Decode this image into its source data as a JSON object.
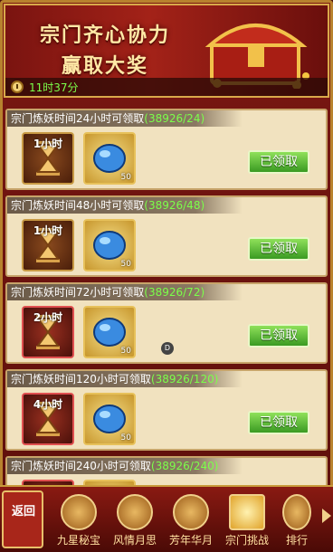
{
  "banner": {
    "title_line1": "宗门齐心协力",
    "title_line2": "赢取大奖",
    "time_left": "11时37分"
  },
  "rewards": [
    {
      "label": "宗门炼妖时间24小时可领取",
      "progress": "(38926/24)",
      "hourglass_text": "1小时",
      "gem_count": "50",
      "button": "已领取",
      "highlight": false
    },
    {
      "label": "宗门炼妖时间48小时可领取",
      "progress": "(38926/48)",
      "hourglass_text": "1小时",
      "gem_count": "50",
      "button": "已领取",
      "highlight": false
    },
    {
      "label": "宗门炼妖时间72小时可领取",
      "progress": "(38926/72)",
      "hourglass_text": "2小时",
      "gem_count": "50",
      "button": "已领取",
      "highlight": true
    },
    {
      "label": "宗门炼妖时间120小时可领取",
      "progress": "(38926/120)",
      "hourglass_text": "4小时",
      "gem_count": "50",
      "button": "已领取",
      "highlight": true
    },
    {
      "label": "宗门炼妖时间240小时可领取",
      "progress": "(38926/240)",
      "hourglass_text": "",
      "gem_count": "",
      "button": "",
      "highlight": true
    }
  ],
  "debug_badge": "D",
  "nav": {
    "back_label": "返回",
    "tabs": [
      {
        "label": "九星秘宝",
        "icon": "stars-emblem-icon"
      },
      {
        "label": "风情月思",
        "icon": "flower-emblem-icon"
      },
      {
        "label": "芳年华月",
        "icon": "bird-emblem-icon"
      },
      {
        "label": "宗门挑战",
        "icon": "gate-emblem-icon",
        "active": true
      },
      {
        "label": "排行",
        "icon": "ranking-emblem-icon"
      }
    ]
  },
  "colors": {
    "claimed_button": "#3a9a22",
    "progress_text": "#7bff4a",
    "card_bg": "#f1e2bf"
  }
}
